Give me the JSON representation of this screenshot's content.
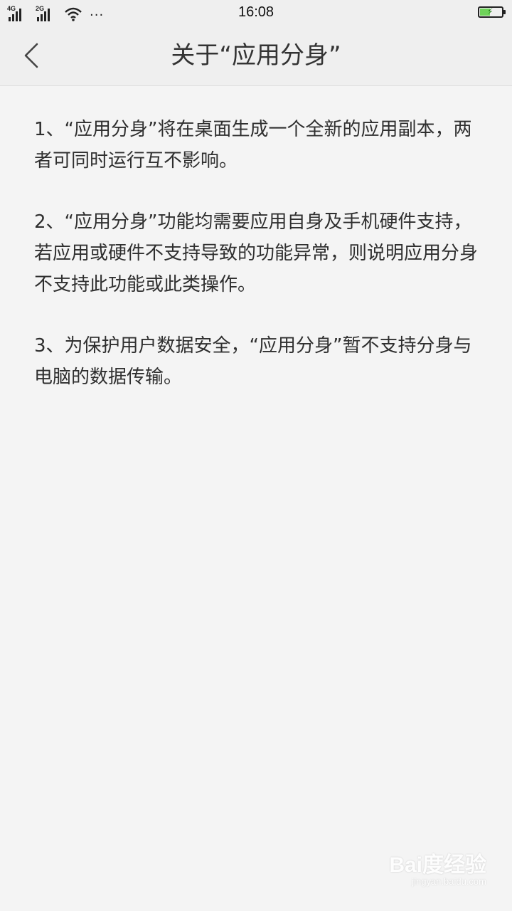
{
  "status_bar": {
    "network_1": "4G",
    "network_2": "2G",
    "more": "···",
    "time": "16:08",
    "battery_level": 0.45,
    "battery_color": "#6fd35a"
  },
  "header": {
    "title": "关于“应用分身”",
    "back_icon": "chevron-left-icon"
  },
  "content": {
    "paragraphs": [
      "1、“应用分身”将在桌面生成一个全新的应用副本，两者可同时运行互不影响。",
      " 2、“应用分身”功能均需要应用自身及手机硬件支持，若应用或硬件不支持导致的功能异常，则说明应用分身不支持此功能或此类操作。",
      " 3、为保护用户数据安全，“应用分身”暂不支持分身与电脑的数据传输。"
    ]
  },
  "watermark": {
    "main": "Bai度经验",
    "sub": "jingyan.baidu.com"
  },
  "colors": {
    "background": "#f4f4f4",
    "header_background": "#efefef",
    "text": "#2f2f2f"
  }
}
